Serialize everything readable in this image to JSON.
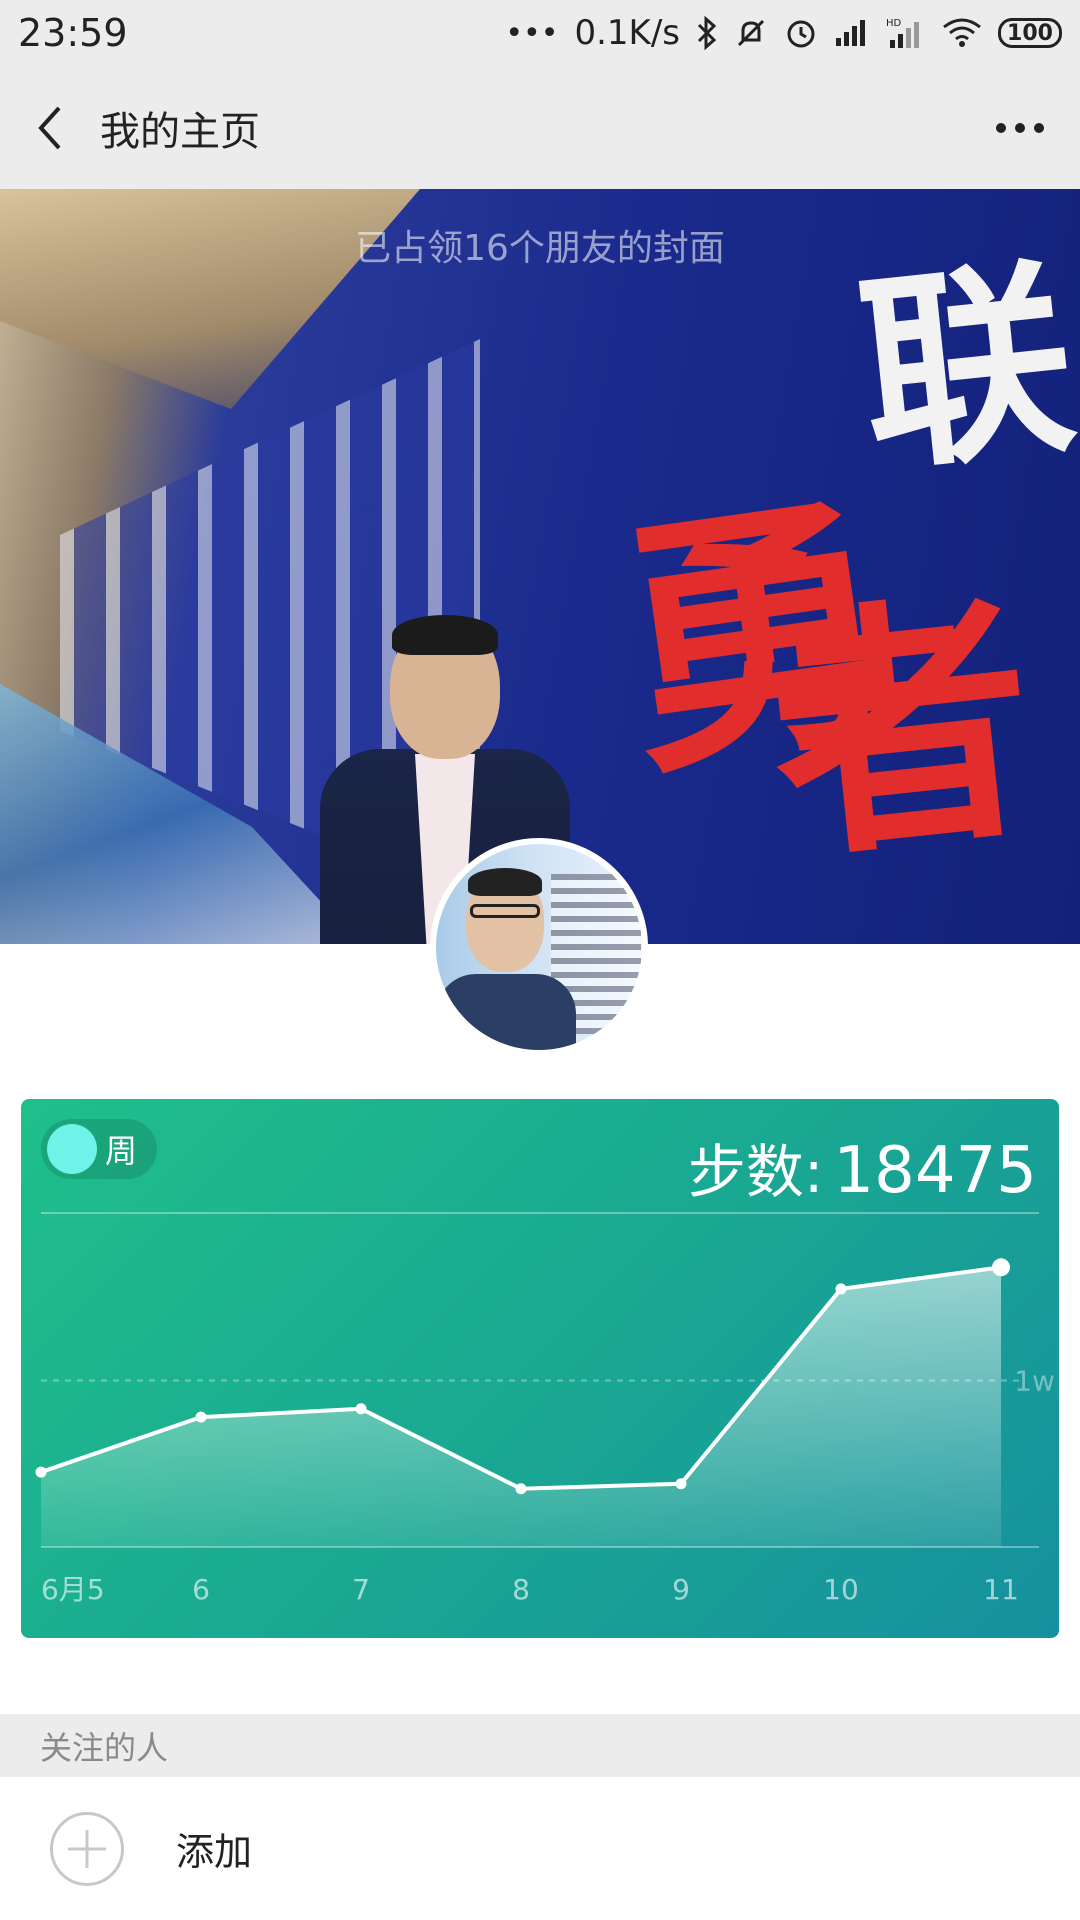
{
  "status_bar": {
    "time": "23:59",
    "dots": "•••",
    "network_speed": "0.1K/s",
    "battery": "100",
    "icons": [
      "bluetooth-icon",
      "mute-icon",
      "alarm-icon",
      "signal-icon",
      "hd-signal-icon",
      "wifi-icon",
      "battery-icon"
    ]
  },
  "header": {
    "title": "我的主页",
    "back_icon": "chevron-left-icon",
    "more_icon": "more-dots-icon"
  },
  "cover": {
    "caption": "已占领16个朋友的封面",
    "calligraphy": [
      "联",
      "勇",
      "者"
    ]
  },
  "step_card": {
    "toggle_label": "周",
    "steps_label": "步数:",
    "steps_value": "18475",
    "reference_label": "1w",
    "colors": {
      "gradient_start": "#1fbf8a",
      "gradient_end": "#16909e",
      "knob": "#6ff2e8"
    }
  },
  "chart_data": {
    "type": "area",
    "categories": [
      "6月5",
      "6",
      "7",
      "8",
      "9",
      "10",
      "11"
    ],
    "values": [
      4500,
      7800,
      8300,
      3500,
      3800,
      15500,
      16800
    ],
    "reference_line": {
      "value": 10000,
      "label": "1w"
    },
    "ylim": [
      0,
      20000
    ],
    "grid": false,
    "title": "",
    "xlabel": "",
    "ylabel": ""
  },
  "follow": {
    "section_title": "关注的人",
    "add_label": "添加",
    "add_icon": "plus-icon"
  }
}
